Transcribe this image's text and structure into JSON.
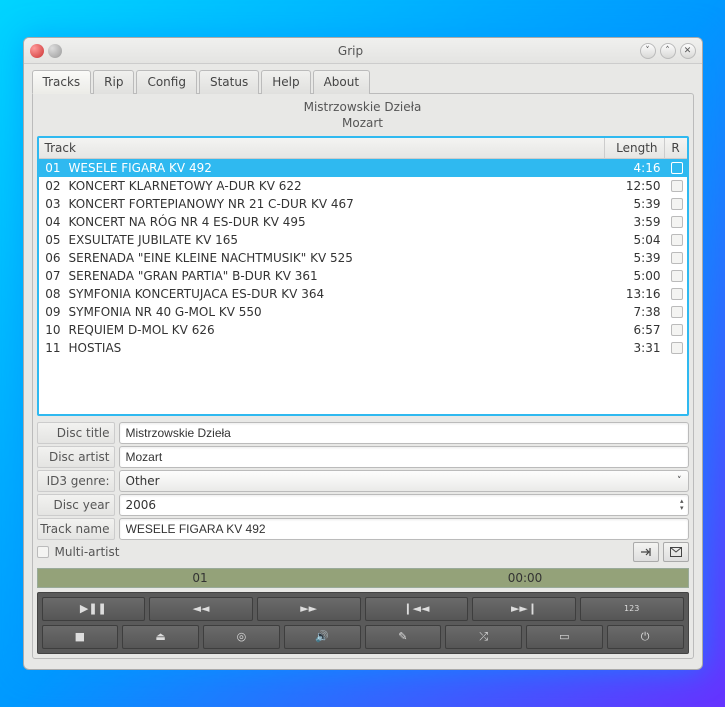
{
  "window": {
    "title": "Grip"
  },
  "tabs": [
    "Tracks",
    "Rip",
    "Config",
    "Status",
    "Help",
    "About"
  ],
  "active_tab": 0,
  "album": {
    "title": "Mistrzowskie Dzieła",
    "artist": "Mozart"
  },
  "columns": {
    "track": "Track",
    "length": "Length",
    "r": "R"
  },
  "tracks": [
    {
      "num": "01",
      "title": "WESELE FIGARA KV 492",
      "length": "4:16",
      "selected": true
    },
    {
      "num": "02",
      "title": "KONCERT KLARNETOWY A-DUR KV 622",
      "length": "12:50"
    },
    {
      "num": "03",
      "title": "KONCERT FORTEPIANOWY NR 21 C-DUR KV 467",
      "length": "5:39"
    },
    {
      "num": "04",
      "title": "KONCERT NA RÓG NR 4 ES-DUR KV 495",
      "length": "3:59"
    },
    {
      "num": "05",
      "title": "EXSULTATE JUBILATE KV 165",
      "length": "5:04"
    },
    {
      "num": "06",
      "title": "SERENADA \"EINE KLEINE NACHTMUSIK\" KV 525",
      "length": "5:39"
    },
    {
      "num": "07",
      "title": "SERENADA \"GRAN PARTIA\" B-DUR KV 361",
      "length": "5:00"
    },
    {
      "num": "08",
      "title": "SYMFONIA KONCERTUJACA ES-DUR KV 364",
      "length": "13:16"
    },
    {
      "num": "09",
      "title": "SYMFONIA NR 40 G-MOL KV 550",
      "length": "7:38"
    },
    {
      "num": "10",
      "title": "REQUIEM D-MOL KV 626",
      "length": "6:57"
    },
    {
      "num": "11",
      "title": "HOSTIAS",
      "length": "3:31"
    }
  ],
  "form": {
    "disc_title_label": "Disc title",
    "disc_title": "Mistrzowskie Dzieła",
    "disc_artist_label": "Disc artist",
    "disc_artist": "Mozart",
    "genre_label": "ID3 genre:",
    "genre": "Other",
    "year_label": "Disc year",
    "year": "2006",
    "track_name_label": "Track name",
    "track_name": "WESELE FIGARA KV 492",
    "multi_artist_label": "Multi-artist"
  },
  "progress": {
    "left": "01",
    "right": "00:00"
  },
  "ctrl_counter": "123"
}
